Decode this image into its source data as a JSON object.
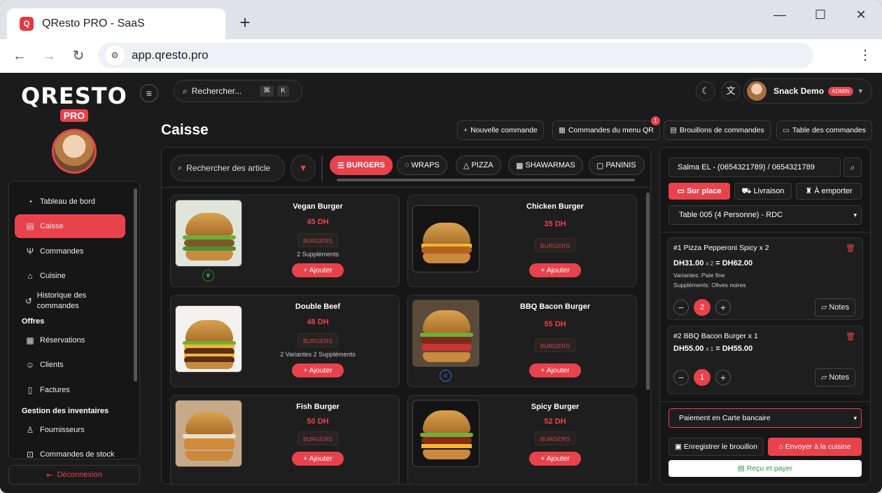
{
  "browser": {
    "tab_title": "QResto PRO - SaaS",
    "favicon_text": "Q",
    "new_tab": "+",
    "url": "app.qresto.pro",
    "win_min": "—",
    "win_max": "☐",
    "win_close": "✕"
  },
  "sidebar": {
    "logo": "QRESTO",
    "logo_sub": "PRO",
    "items": [
      {
        "label": "Tableau de bord",
        "icon": "speedometer-icon",
        "glyph": "◔"
      },
      {
        "label": "Caisse",
        "icon": "cash-register-icon",
        "glyph": "▤"
      },
      {
        "label": "Commandes",
        "icon": "fork-knife-icon",
        "glyph": "Ψ"
      },
      {
        "label": "Cuisine",
        "icon": "chef-hat-icon",
        "glyph": "⌂"
      },
      {
        "label": "Historique des commandes",
        "icon": "history-icon",
        "glyph": "↺"
      },
      {
        "label": "Réservations",
        "icon": "calendar-icon",
        "glyph": "▦"
      },
      {
        "label": "Clients",
        "icon": "users-icon",
        "glyph": "☺"
      },
      {
        "label": "Factures",
        "icon": "document-icon",
        "glyph": "▯"
      },
      {
        "label": "Fournisseurs",
        "icon": "supplier-icon",
        "glyph": "♙"
      },
      {
        "label": "Commandes de stock",
        "icon": "cart-icon",
        "glyph": "⊡"
      }
    ],
    "sections": {
      "offres": "Offres",
      "inventaire": "Gestion des inventaires"
    },
    "logout": "Déconnexion"
  },
  "header": {
    "search_placeholder": "Rechercher...",
    "kbd1": "⌘",
    "kbd2": "K",
    "user_name": "Snack Demo",
    "user_role": "ADMIN"
  },
  "page": {
    "title": "Caisse",
    "actions": [
      {
        "label": "Nouvelle commande",
        "glyph": "+"
      },
      {
        "label": "Commandes du menu QR",
        "glyph": "▦"
      },
      {
        "label": "Brouillons de commandes",
        "glyph": "▤"
      },
      {
        "label": "Table des commandes",
        "glyph": "▭"
      }
    ],
    "qr_badge": "1"
  },
  "menu": {
    "search_placeholder": "Rechercher des article",
    "categories": [
      "BURGERS",
      "WRAPS",
      "PIZZA",
      "SHAWARMAS",
      "PANINIS"
    ],
    "add_label": "Ajouter",
    "products": [
      {
        "name": "Vegan Burger",
        "price": "45 DH",
        "category": "BURGERS",
        "extra": "2 Suppléments"
      },
      {
        "name": "Chicken Burger",
        "price": "35 DH",
        "category": "BURGERS",
        "extra": ""
      },
      {
        "name": "Double Beef",
        "price": "48 DH",
        "category": "BURGERS",
        "extra": "2 Variantes 2 Suppléments"
      },
      {
        "name": "BBQ Bacon Burger",
        "price": "55 DH",
        "category": "BURGERS",
        "extra": ""
      },
      {
        "name": "Fish Burger",
        "price": "50 DH",
        "category": "BURGERS",
        "extra": ""
      },
      {
        "name": "Spicy Burger",
        "price": "52 DH",
        "category": "BURGERS",
        "extra": ""
      }
    ]
  },
  "order": {
    "customer": "Salma EL - (0654321789) / 0654321789",
    "types": [
      "Sur place",
      "Livraison",
      "À emporter"
    ],
    "table": "Table 005 (4 Personne) - RDC",
    "lines": [
      {
        "title": "#1 Pizza Pepperoni Spicy x 2",
        "unit": "DH31.00",
        "mult": "x 2",
        "total": "= DH62.00",
        "variantes": "Variantes: Pate fine",
        "supplements": "Suppléments: Olives noires",
        "qty": "2"
      },
      {
        "title": "#2 BBQ Bacon Burger x 1",
        "unit": "DH55.00",
        "mult": "x 1",
        "total": "= DH55.00",
        "qty": "1"
      }
    ],
    "notes_label": "Notes",
    "payment": "Paiement en Carte bancaire",
    "save_draft": "Enregistrer le brouillon",
    "send_kitchen": "Envoyer à la cuisine",
    "pay": "Reçu et payer"
  },
  "colors": {
    "accent": "#e8424c",
    "bg": "#1b1b1b",
    "panel": "#161616"
  }
}
